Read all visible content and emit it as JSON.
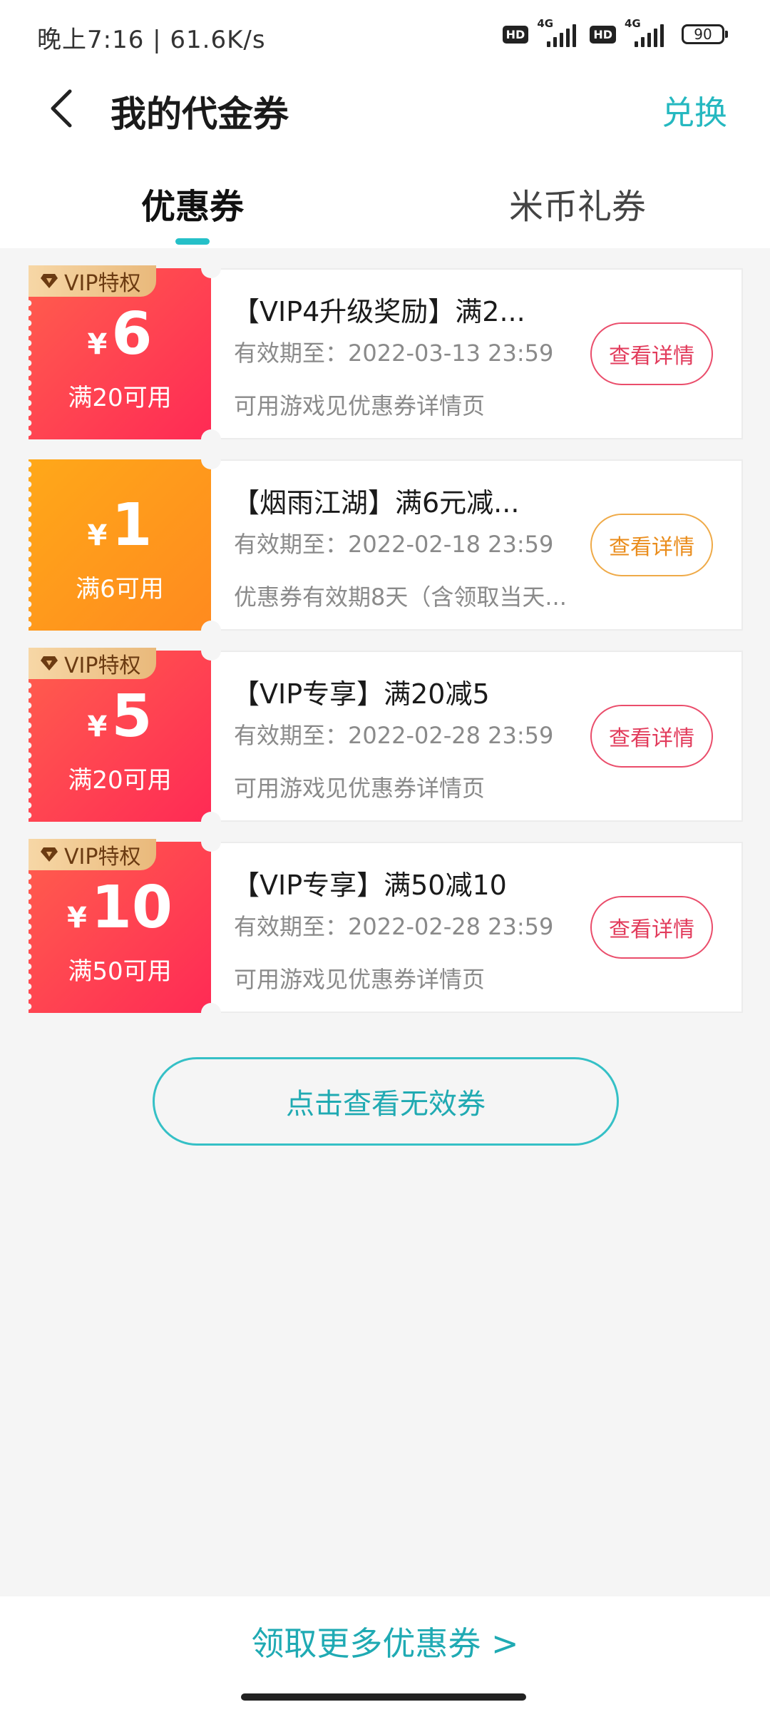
{
  "status_bar": {
    "time_speed": "晚上7:16 | 61.6K/s",
    "hd1": "HD",
    "net1": "4G",
    "hd2": "HD",
    "net2": "4G",
    "battery": "90"
  },
  "header": {
    "title": "我的代金券",
    "exchange": "兑换"
  },
  "tabs": [
    {
      "label": "优惠券",
      "active": true
    },
    {
      "label": "米币礼券",
      "active": false
    }
  ],
  "coupons": [
    {
      "vip_tag": "VIP特权",
      "currency": "¥",
      "amount": "6",
      "condition": "满20可用",
      "color": "red",
      "title": "【VIP4升级奖励】满2...",
      "validity": "有效期至：2022-03-13 23:59",
      "description": "可用游戏见优惠券详情页",
      "button": "查看详情"
    },
    {
      "vip_tag": "",
      "currency": "¥",
      "amount": "1",
      "condition": "满6可用",
      "color": "orange",
      "title": "【烟雨江湖】满6元减...",
      "validity": "有效期至：2022-02-18 23:59",
      "description": "优惠券有效期8天（含领取当天...",
      "button": "查看详情"
    },
    {
      "vip_tag": "VIP特权",
      "currency": "¥",
      "amount": "5",
      "condition": "满20可用",
      "color": "red",
      "title": "【VIP专享】满20减5",
      "validity": "有效期至：2022-02-28 23:59",
      "description": "可用游戏见优惠券详情页",
      "button": "查看详情"
    },
    {
      "vip_tag": "VIP特权",
      "currency": "¥",
      "amount": "10",
      "condition": "满50可用",
      "color": "red",
      "title": "【VIP专享】满50减10",
      "validity": "有效期至：2022-02-28 23:59",
      "description": "可用游戏见优惠券详情页",
      "button": "查看详情"
    }
  ],
  "invalid_button": "点击查看无效券",
  "footer": {
    "more_link": "领取更多优惠券 >"
  },
  "colors": {
    "accent": "#25b8c0",
    "coupon_red_start": "#ff5e4d",
    "coupon_red_end": "#ff2a55",
    "coupon_orange_start": "#ffa819",
    "coupon_orange_end": "#ff8a1f",
    "vip_gold": "#e9b97b"
  },
  "icons": {
    "back": "chevron-left-icon",
    "vip": "diamond-icon",
    "signal": "signal-icon",
    "battery": "battery-icon"
  }
}
